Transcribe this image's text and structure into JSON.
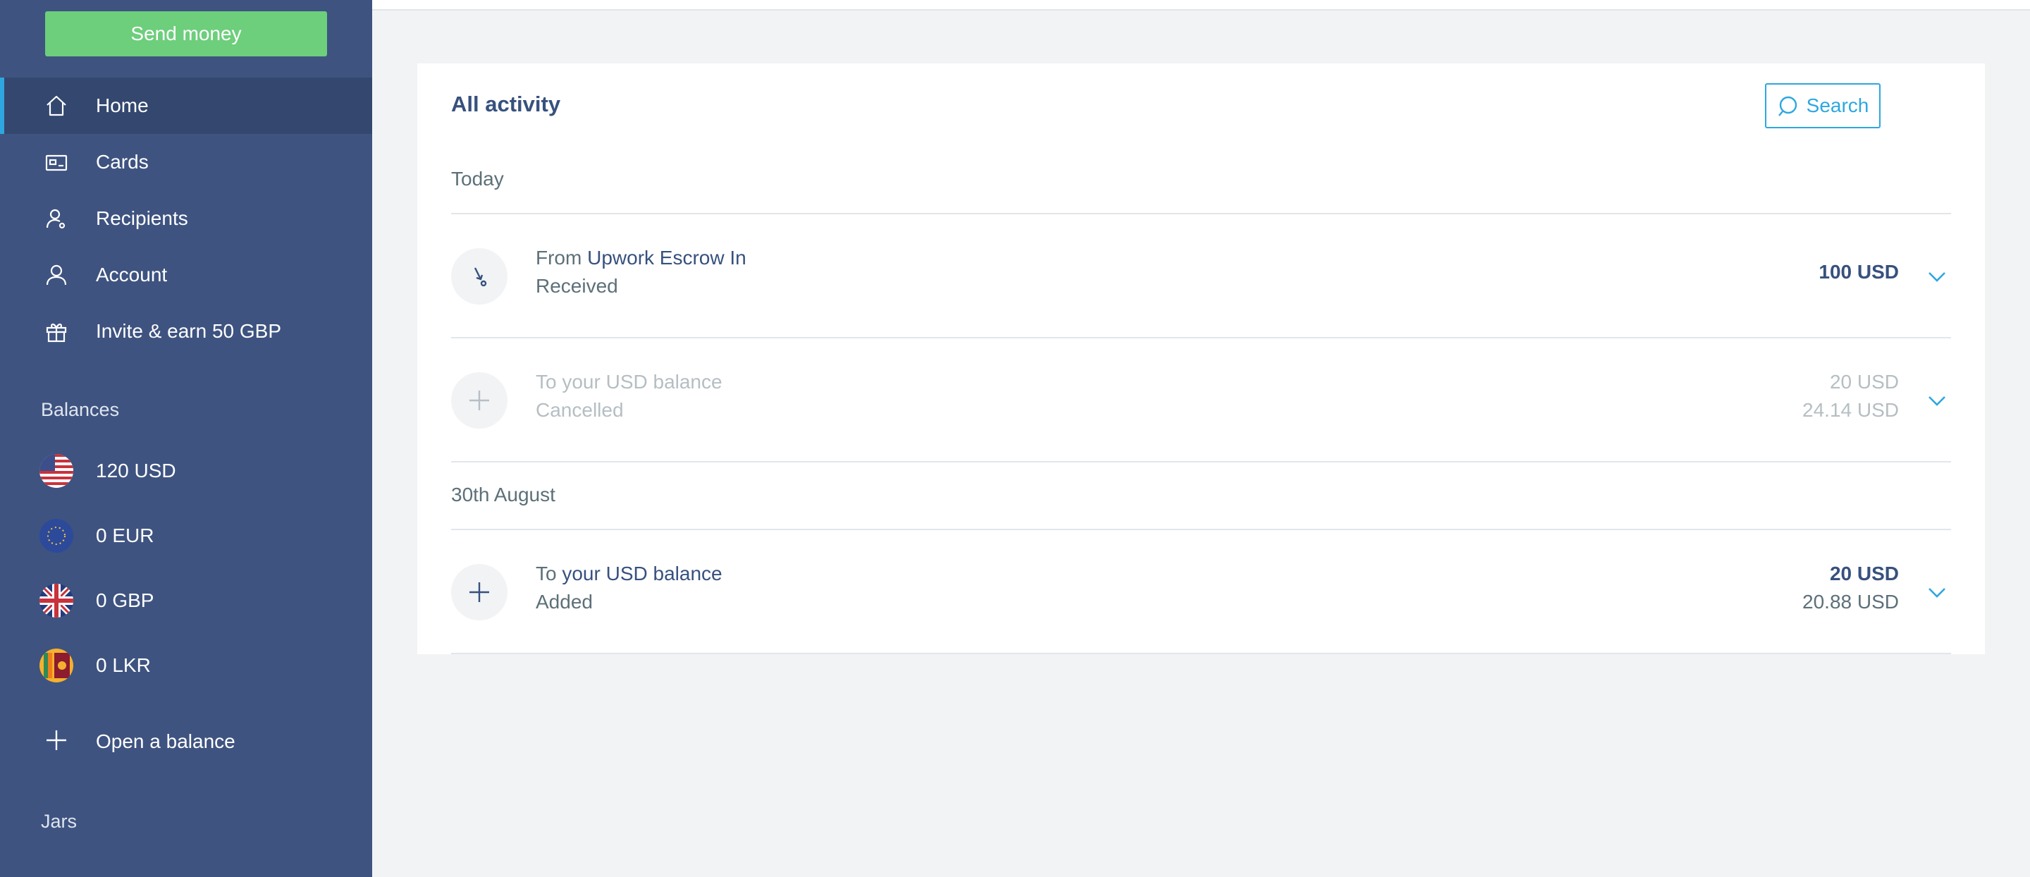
{
  "sidebar": {
    "send_money": "Send money",
    "nav": [
      {
        "label": "Home",
        "icon": "home-icon"
      },
      {
        "label": "Cards",
        "icon": "card-icon"
      },
      {
        "label": "Recipients",
        "icon": "recipients-icon"
      },
      {
        "label": "Account",
        "icon": "account-icon"
      },
      {
        "label": "Invite & earn 50 GBP",
        "icon": "gift-icon"
      }
    ],
    "balances_title": "Balances",
    "balances": [
      {
        "label": "120 USD",
        "flag": "us-flag-icon"
      },
      {
        "label": "0 EUR",
        "flag": "eu-flag-icon"
      },
      {
        "label": "0 GBP",
        "flag": "uk-flag-icon"
      },
      {
        "label": "0 LKR",
        "flag": "lk-flag-icon"
      }
    ],
    "open_balance": "Open a balance",
    "jars_title": "Jars"
  },
  "main": {
    "title": "All activity",
    "search_label": "Search",
    "groups": [
      {
        "date": "Today",
        "items": [
          {
            "prefix": "From ",
            "name": "Upwork Escrow In",
            "status": "Received",
            "amount": "100 USD",
            "amount2": "",
            "icon": "receive-icon"
          },
          {
            "prefix": "To your USD balance",
            "name": "",
            "status": "Cancelled",
            "amount": "20 USD",
            "amount2": "24.14 USD",
            "icon": "plus-icon"
          }
        ]
      },
      {
        "date": "30th August",
        "items": [
          {
            "prefix": "To ",
            "name": "your USD balance",
            "status": "Added",
            "amount": "20 USD",
            "amount2": "20.88 USD",
            "icon": "plus-icon"
          }
        ]
      }
    ]
  },
  "colors": {
    "sidebar_bg": "#3e5380",
    "sidebar_active": "#34476f",
    "accent_blue": "#2ea7e0",
    "send_green": "#6dce7c",
    "text_dark": "#37517e",
    "text_muted": "#5d7079"
  }
}
